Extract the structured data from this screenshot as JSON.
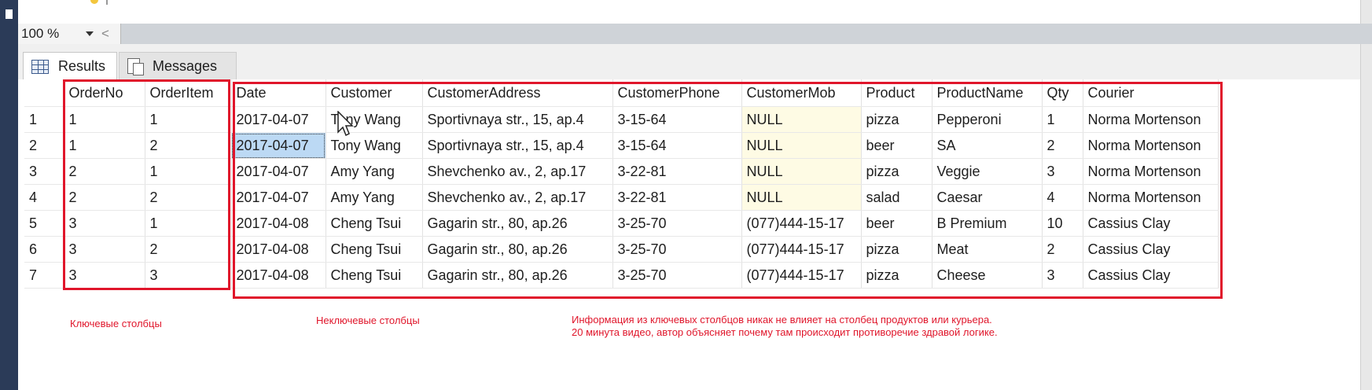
{
  "zoom": {
    "value": "100 %",
    "scroll_left": "<"
  },
  "tabs": [
    {
      "label": "Results",
      "icon": "grid-icon",
      "active": true
    },
    {
      "label": "Messages",
      "icon": "messages-icon",
      "active": false
    }
  ],
  "results": {
    "columns": [
      "",
      "OrderNo",
      "OrderItem",
      "Date",
      "Customer",
      "CustomerAddress",
      "CustomerPhone",
      "CustomerMob",
      "Product",
      "ProductName",
      "Qty",
      "Courier"
    ],
    "rows": [
      [
        "1",
        "1",
        "1",
        "2017-04-07",
        "Tony Wang",
        "Sportivnaya str., 15, ap.4",
        "3-15-64",
        "NULL",
        "pizza",
        "Pepperoni",
        "1",
        "Norma Mortenson"
      ],
      [
        "2",
        "1",
        "2",
        "2017-04-07",
        "Tony Wang",
        "Sportivnaya str., 15, ap.4",
        "3-15-64",
        "NULL",
        "beer",
        "SA",
        "2",
        "Norma Mortenson"
      ],
      [
        "3",
        "2",
        "1",
        "2017-04-07",
        "Amy Yang",
        "Shevchenko av., 2, ap.17",
        "3-22-81",
        "NULL",
        "pizza",
        "Veggie",
        "3",
        "Norma Mortenson"
      ],
      [
        "4",
        "2",
        "2",
        "2017-04-07",
        "Amy Yang",
        "Shevchenko av., 2, ap.17",
        "3-22-81",
        "NULL",
        "salad",
        "Caesar",
        "4",
        "Norma Mortenson"
      ],
      [
        "5",
        "3",
        "1",
        "2017-04-08",
        "Cheng Tsui",
        "Gagarin str., 80, ap.26",
        "3-25-70",
        "(077)444-15-17",
        "beer",
        "B Premium",
        "10",
        "Cassius Clay"
      ],
      [
        "6",
        "3",
        "2",
        "2017-04-08",
        "Cheng Tsui",
        "Gagarin str., 80, ap.26",
        "3-25-70",
        "(077)444-15-17",
        "pizza",
        "Meat",
        "2",
        "Cassius Clay"
      ],
      [
        "7",
        "3",
        "3",
        "2017-04-08",
        "Cheng Tsui",
        "Gagarin str., 80, ap.26",
        "3-25-70",
        "(077)444-15-17",
        "pizza",
        "Cheese",
        "3",
        "Cassius Clay"
      ]
    ]
  },
  "annotations": {
    "key_columns": "Ключевые столбцы",
    "non_key_columns": "Неключевые столбцы",
    "note_line1": "Информация из ключевых столбцов никак не влияет на столбец продуктов или курьера.",
    "note_line2": "20 минута видео, автор объясняет почему там происходит противоречие здравой логике."
  },
  "colors": {
    "annotation_red": "#e0162b",
    "null_bg": "#fefbe4",
    "selection_bg": "#bcd9f4"
  }
}
